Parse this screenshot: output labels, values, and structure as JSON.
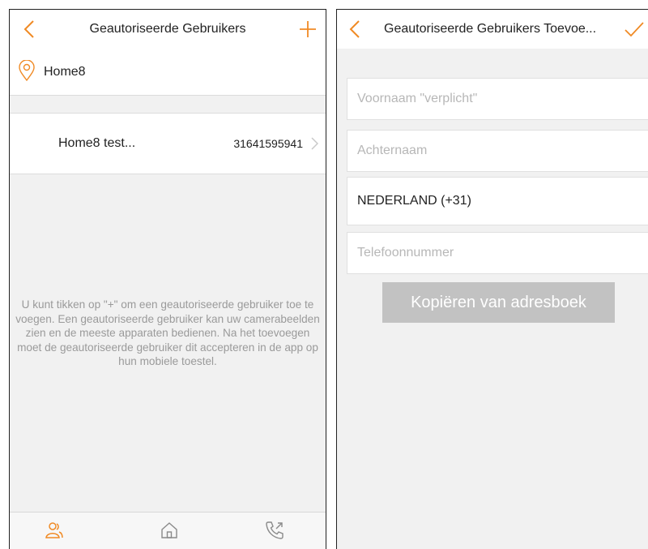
{
  "colors": {
    "accent": "#f08a24",
    "border": "#dcdcdc",
    "background": "#f1f1f1",
    "button_grey": "#c2c2c2"
  },
  "left": {
    "header": {
      "title": "Geautoriseerde Gebruikers",
      "back_icon": "chevron-left-icon",
      "add_icon": "plus-icon"
    },
    "location": {
      "icon": "location-pin-icon",
      "name": "Home8"
    },
    "users": [
      {
        "name": "Home8 test...",
        "phone": "31641595941"
      }
    ],
    "hint": "U kunt tikken op \"+\" om een geautoriseerde gebruiker toe te voegen. Een geautoriseerde gebruiker kan uw camerabeelden zien en de meeste apparaten bedienen. Na het toevoegen moet de geautoriseerde gebruiker dit accepteren in de app op hun mobiele toestel.",
    "tabs": [
      {
        "icon": "users-icon",
        "active": true
      },
      {
        "icon": "home-icon",
        "active": false
      },
      {
        "icon": "phone-call-icon",
        "active": false
      }
    ]
  },
  "right": {
    "header": {
      "title": "Geautoriseerde Gebruikers Toevoe...",
      "back_icon": "chevron-left-icon",
      "confirm_icon": "checkmark-icon"
    },
    "fields": {
      "first_name_placeholder": "Voornaam \"verplicht\"",
      "last_name_placeholder": "Achternaam",
      "country": "NEDERLAND (+31)",
      "phone_placeholder": "Telefoonnummer"
    },
    "copy_button": "Kopiëren van adresboek"
  }
}
